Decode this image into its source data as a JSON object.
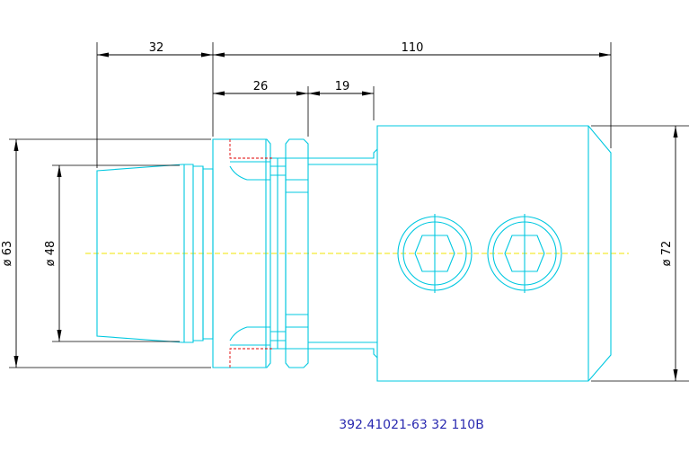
{
  "drawing": {
    "part_number": "392.41021-63 32 110B",
    "dimensions": {
      "len_32": "32",
      "len_110": "110",
      "len_26": "26",
      "len_19": "19",
      "dia_63": "ø 63",
      "dia_48": "ø 48",
      "dia_72": "ø 72"
    },
    "colors": {
      "outline": "#00c8e0",
      "centerline": "#f2e600",
      "hidden": "#e00000",
      "dimension": "#000000",
      "label": "#2a2ab0"
    }
  }
}
